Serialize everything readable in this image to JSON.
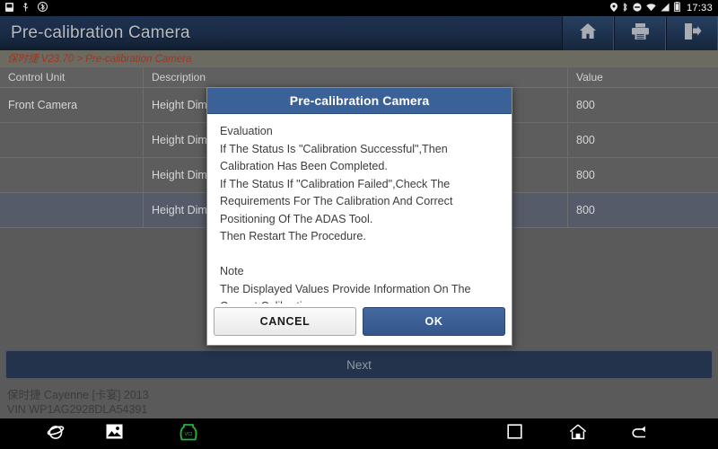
{
  "status_bar": {
    "left_icons": [
      "sd-card-icon",
      "usb-icon",
      "bluetooth-settings-icon"
    ],
    "right_icons": [
      "location-icon",
      "bluetooth-icon",
      "do-not-disturb-icon",
      "wifi-icon",
      "signal-icon",
      "battery-icon"
    ],
    "clock": "17:33"
  },
  "header": {
    "title": "Pre-calibration Camera",
    "actions": [
      {
        "name": "home-button",
        "icon": "home-icon"
      },
      {
        "name": "print-button",
        "icon": "printer-icon"
      },
      {
        "name": "exit-button",
        "icon": "exit-icon"
      }
    ]
  },
  "breadcrumb": {
    "text": "保时捷 V23.70 > Pre-calibration Camera"
  },
  "table": {
    "columns": [
      "Control Unit",
      "Description",
      "Value"
    ],
    "rows": [
      {
        "unit": "Front Camera",
        "description": "Height Dimension",
        "value": "800",
        "selected": false
      },
      {
        "unit": "",
        "description": "Height Dimension",
        "value": "800",
        "selected": false
      },
      {
        "unit": "",
        "description": "Height Dimension",
        "value": "800",
        "selected": false
      },
      {
        "unit": "",
        "description": "Height Dimension",
        "value": "800",
        "selected": true
      }
    ]
  },
  "next_button": {
    "label": "Next"
  },
  "vehicle_info": {
    "model": "保时捷 Cayenne [卡宴] 2013",
    "vin": "VIN WP1AG2928DLA54391"
  },
  "dialog": {
    "title": "Pre-calibration Camera",
    "message": "Evaluation\nIf The Status Is \"Calibration Successful\",Then Calibration Has Been Completed.\nIf The Status If \"Calibration Failed\",Check The Requirements For The Calibration And Correct Positioning Of The ADAS Tool.\nThen Restart The Procedure.\n\nNote\nThe Displayed Values Provide Information On The Current Calibration.",
    "cancel_label": "CANCEL",
    "ok_label": "OK"
  },
  "nav_bar": {
    "items": [
      {
        "name": "nav-browser",
        "icon": "browser-icon"
      },
      {
        "name": "nav-gallery",
        "icon": "gallery-icon"
      },
      {
        "name": "nav-vci",
        "icon": "vci-connector-icon"
      },
      {
        "name": "nav-recent",
        "icon": "recents-square-icon"
      },
      {
        "name": "nav-home",
        "icon": "home-outline-icon"
      },
      {
        "name": "nav-back",
        "icon": "back-arrow-icon"
      }
    ]
  },
  "colors": {
    "header_navy": "#1a2b46",
    "dialog_blue": "#3b6298",
    "ok_blue": "#34578b",
    "breadcrumb_red": "#a5341f",
    "page_gray": "#5a5a5a",
    "vci_green": "#21b836"
  }
}
